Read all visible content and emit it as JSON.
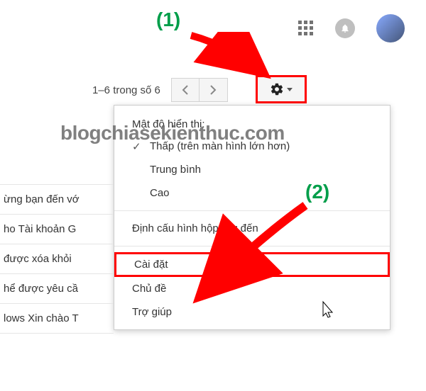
{
  "topbar": {
    "apps_icon": "apps-grid",
    "notifications_icon": "bell",
    "avatar": "user-avatar"
  },
  "pagination": {
    "range_text": "1–6 trong số 6",
    "prev": "‹",
    "next": "›"
  },
  "settings_button": {
    "icon": "gear",
    "caret": "▾"
  },
  "dropdown": {
    "density_label": "Mật độ hiển thị:",
    "items": [
      "Thấp (trên màn hình lớn hơn)",
      "Trung bình",
      "Cao"
    ],
    "config_inbox": "Định cấu hình hộp thư đến",
    "settings": "Cài đặt",
    "themes": "Chủ đề",
    "help": "Trợ giúp"
  },
  "email_rows": [
    "ừng bạn đến vớ",
    "ho Tài khoản G",
    "được xóa khỏi",
    "hể được yêu cầ",
    "lows Xin chào T"
  ],
  "annotations": {
    "step1": "(1)",
    "step2": "(2)"
  },
  "watermark": "blogchiasekienthuc.com"
}
